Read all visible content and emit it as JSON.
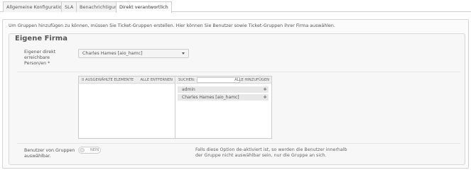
{
  "tabs": [
    {
      "label": "Allgemeine Konfiguration"
    },
    {
      "label": "SLA"
    },
    {
      "label": "Benachrichtigung"
    },
    {
      "label": "Direkt verantwortlich"
    }
  ],
  "intro": "Um Gruppen hinzufügen zu können, müssen Sie Ticket-Gruppen erstellen. Hier können Sie Benutzer sowie Ticket-Gruppen ihrer Firma auswählen.",
  "section": {
    "title": "Eigene Firma",
    "direct_person": {
      "label_lines": [
        "Eigener direkt",
        "erreichbare",
        "Person/en *"
      ],
      "selected_value": "Charles Hames [aio_hamc]"
    },
    "multiselect": {
      "selected_header": "0 AUSGEWÄHLTE ELEMENTE",
      "remove_all": "ALLE ENTFERNEN",
      "search_label": "SUCHEN:",
      "search_value": "",
      "add_all": "ALLE HINZUFÜGEN",
      "available_items": [
        {
          "label": "admin",
          "plus": "+"
        },
        {
          "label": "Charles Hames [aio_hamc]",
          "plus": "+"
        }
      ]
    },
    "groups_selectable": {
      "label_lines": [
        "Benutzer von Gruppen",
        "auswählbar."
      ],
      "toggle_text": "NEIN",
      "help_lines": [
        "Falls diese Option de-aktiviert ist, so werden die Benutzer innerhalb",
        "der Gruppe nicht auswählbar sein, nur die Gruppe an sich."
      ]
    }
  }
}
